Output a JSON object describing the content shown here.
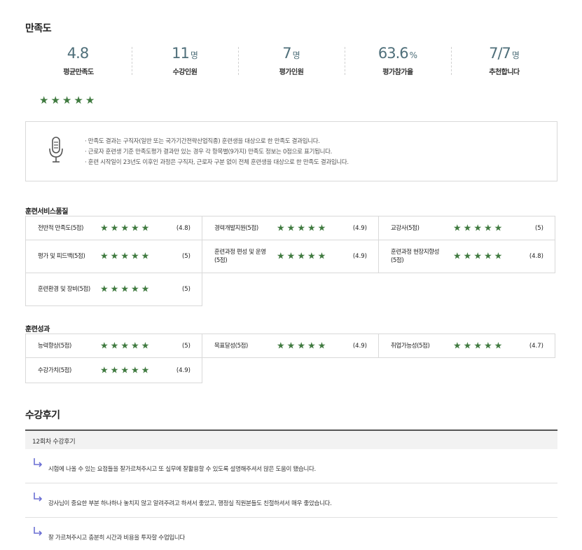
{
  "satisfaction": {
    "title": "만족도",
    "stats": [
      {
        "value": "4.8",
        "unit": "",
        "label": "평균만족도"
      },
      {
        "value": "11",
        "unit": "명",
        "label": "수강인원"
      },
      {
        "value": "7",
        "unit": "명",
        "label": "평가인원"
      },
      {
        "value": "63.6",
        "unit": "%",
        "label": "평가참가율"
      },
      {
        "value": "7/7",
        "unit": "명",
        "label": "추천합니다"
      }
    ],
    "overall_stars": 5,
    "notice_icon": "microphone-icon",
    "notices": [
      "· 만족도 결과는 구직자(일반 또는 국가기간전략산업직종) 훈련생을 대상으로 한 만족도 결과입니다.",
      "· 근로자 훈련생 기준 만족도평가 결과만 있는 경우 각 항목별(9가지) 만족도 정보는 0점으로 표기됩니다.",
      "· 훈련 시작일이 23년도 이후인 과정은 구직자, 근로자 구분 없이 전체 훈련생을 대상으로 한 만족도 결과입니다."
    ]
  },
  "service_quality": {
    "title": "훈련서비스품질",
    "items": [
      {
        "name": "전반적 만족도(5점)",
        "stars": 5,
        "score": "(4.8)"
      },
      {
        "name": "경력개발지원(5점)",
        "stars": 5,
        "score": "(4.9)"
      },
      {
        "name": "교강사(5점)",
        "stars": 5,
        "score": "(5)"
      },
      {
        "name": "평가 및 피드백(5점)",
        "stars": 5,
        "score": "(5)"
      },
      {
        "name": "훈련과정 편성 및 운영(5점)",
        "stars": 5,
        "score": "(4.9)"
      },
      {
        "name": "훈련과정 현장지향성(5점)",
        "stars": 5,
        "score": "(4.8)"
      },
      {
        "name": "훈련환경 및 장비(5점)",
        "stars": 5,
        "score": "(5)"
      }
    ]
  },
  "training_outcome": {
    "title": "훈련성과",
    "items": [
      {
        "name": "능력향상(5점)",
        "stars": 5,
        "score": "(5)"
      },
      {
        "name": "목표달성(5점)",
        "stars": 5,
        "score": "(4.9)"
      },
      {
        "name": "취업가능성(5점)",
        "stars": 5,
        "score": "(4.7)"
      },
      {
        "name": "수강가치(5점)",
        "stars": 5,
        "score": "(4.9)"
      }
    ]
  },
  "reviews": {
    "title": "수강후기",
    "header": "12회차 수강후기",
    "items": [
      "시험에 나올 수 있는 요점들을 잘가르쳐주시고 또 실무에 잘활용할 수 있도록 설명해주셔서 많은 도움이 됐습니다.",
      "강사님이 중요한 부분 하나하나 놓치지 않고 알려주려고 하셔서 좋았고, 행정실 직원분들도 친절하셔서 매우 좋았습니다.",
      "잘 가르쳐주시고 충분히 시간과 비용을 투자할 수업입니다"
    ]
  },
  "colors": {
    "star": "#3f7a3f",
    "stat_value": "#4f6f7a",
    "reply_arrow": "#6b6fd4"
  }
}
